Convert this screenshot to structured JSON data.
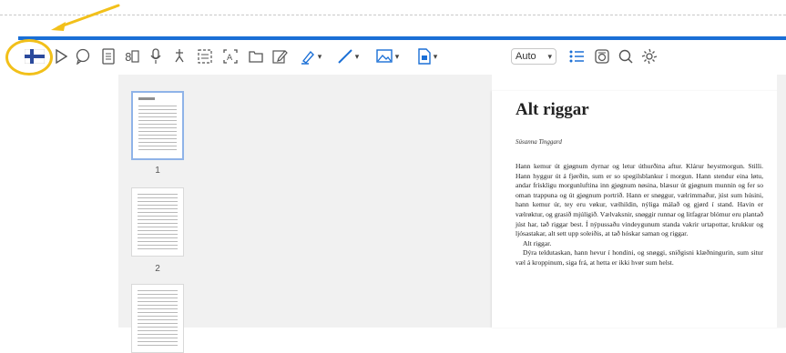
{
  "toolbar": {
    "icons": [
      "flag-icon",
      "play-icon",
      "speech-bubble-icon",
      "dictionary-icon",
      "syllables-icon",
      "microphone-icon",
      "ear-icon",
      "screen-reader-icon",
      "translate-icon",
      "folder-icon",
      "edit-icon",
      "highlighter-icon",
      "line-icon",
      "image-icon",
      "document-icon",
      "list-icon",
      "camera-icon",
      "search-icon",
      "settings-icon"
    ],
    "zoom_value": "Auto",
    "accent_color": "#1a6fd6",
    "highlight_color": "#f2c01a"
  },
  "sidebar": {
    "thumbnails": [
      {
        "page": "1",
        "selected": true
      },
      {
        "page": "2",
        "selected": false
      },
      {
        "page": "",
        "selected": false
      }
    ]
  },
  "document": {
    "title": "Alt riggar",
    "author": "Súsanna Tinggard",
    "paragraphs": [
      "Hann kemur út gjøgnum dyrnar og letur úthurðina aftur. Klárur heystmorgun. Stilli. Hann hyggur út á fjørðin, sum er so spegilsblankur í morgun. Hann stendur eina løtu, andar frískligu morgunluftina inn gjøgnum nøsina, blæsur út gjøgnum munnin og fer so oman trappuna og út gjøgnum portrið. Hann er snøggur, vælrimmaður, júst sum húsini, hann kemur úr, tey eru vøkur, vælhildin, nýliga málað og gjørd í stand. Havin er vælrøktur, og grasið mjúligið. Vælvaksnir, snøggir runnar og litfagrar blómur eru plantað júst har, tað riggar best. Í nýpussaðu vindeygunum standa vakrir urtapottar, krukkur og ljósastakar, alt sett upp soleiðis, at tað hóskar saman og riggar.",
      "Alt riggar.",
      "Dýra teldutaskan, hann hevur í hondini, og snøggi, sniðgisni klæðningurin, sum situr væl á kroppinum, siga frá, at hetta er ikki hvør sum helst."
    ]
  }
}
